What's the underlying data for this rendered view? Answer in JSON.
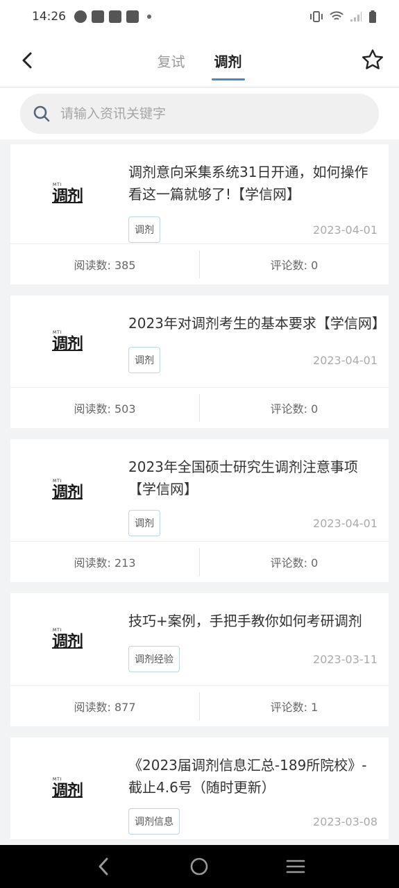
{
  "status_bar": {
    "time": "14:26"
  },
  "header": {
    "tabs": [
      {
        "label": "复试",
        "active": false
      },
      {
        "label": "调剂",
        "active": true
      }
    ]
  },
  "search": {
    "placeholder": "请输入资讯关键字"
  },
  "logo": {
    "small": "MTI",
    "main": "调剂"
  },
  "articles": [
    {
      "title": "调剂意向采集系统31日开通，如何操作看这一篇就够了!【学信网】",
      "tag": "调剂",
      "date": "2023-04-01",
      "reads": "阅读数: 385",
      "comments": "评论数: 0"
    },
    {
      "title": "2023年对调剂考生的基本要求【学信网】",
      "tag": "调剂",
      "date": "2023-04-01",
      "reads": "阅读数: 503",
      "comments": "评论数: 0"
    },
    {
      "title": "2023年全国硕士研究生调剂注意事项【学信网】",
      "tag": "调剂",
      "date": "2023-04-01",
      "reads": "阅读数: 213",
      "comments": "评论数: 0"
    },
    {
      "title": "技巧+案例，手把手教你如何考研调剂",
      "tag": "调剂经验",
      "date": "2023-03-11",
      "reads": "阅读数: 877",
      "comments": "评论数: 1"
    },
    {
      "title": "《2023届调剂信息汇总-189所院校》-截止4.6号（随时更新）",
      "tag": "调剂信息",
      "date": "2023-03-08",
      "reads": "",
      "comments": ""
    }
  ],
  "colors": {
    "accent": "#4a86c7",
    "tag_border": "#bcd6e8",
    "background": "#f2f3f5"
  }
}
